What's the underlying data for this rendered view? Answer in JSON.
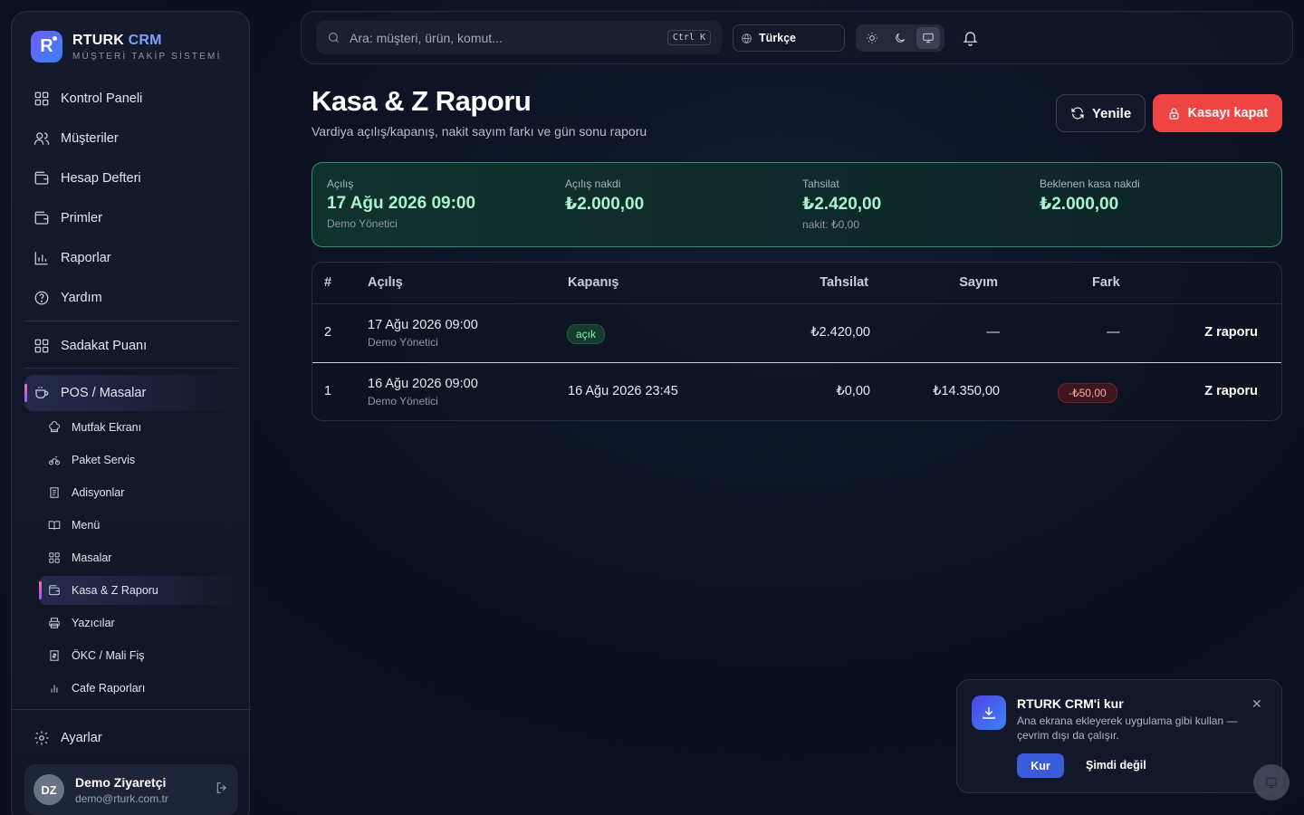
{
  "brand": {
    "name": "RTURK",
    "accent": "CRM",
    "subtitle": "MÜŞTERİ TAKİP SİSTEMİ",
    "logo_letter": "R"
  },
  "sidebar": {
    "items": [
      {
        "label": "Kontrol Paneli",
        "icon": "grid-icon"
      },
      {
        "label": "Müşteriler",
        "icon": "users-icon"
      },
      {
        "label": "Hesap Defteri",
        "icon": "wallet-icon"
      },
      {
        "label": "Primler",
        "icon": "wallet-icon"
      },
      {
        "label": "Raporlar",
        "icon": "bar-chart-icon"
      },
      {
        "label": "Yardım",
        "icon": "help-circle-icon"
      }
    ],
    "loyalty": {
      "label": "Sadakat Puanı",
      "icon": "grid-icon"
    },
    "pos": {
      "label": "POS / Masalar",
      "icon": "coffee-cup-icon"
    },
    "pos_sub": [
      {
        "label": "Mutfak Ekranı",
        "icon": "chef-hat-icon"
      },
      {
        "label": "Paket Servis",
        "icon": "bike-icon"
      },
      {
        "label": "Adisyonlar",
        "icon": "receipt-icon"
      },
      {
        "label": "Menü",
        "icon": "book-icon"
      },
      {
        "label": "Masalar",
        "icon": "grid-icon"
      },
      {
        "label": "Kasa & Z Raporu",
        "icon": "wallet-icon"
      },
      {
        "label": "Yazıcılar",
        "icon": "printer-icon"
      },
      {
        "label": "ÖKC / Mali Fiş",
        "icon": "receipt-icon"
      },
      {
        "label": "Cafe Raporları",
        "icon": "bar-chart-icon"
      }
    ],
    "settings": {
      "label": "Ayarlar",
      "icon": "gear-icon"
    },
    "user": {
      "initials": "DZ",
      "name": "Demo Ziyaretçi",
      "email": "demo@rturk.com.tr"
    }
  },
  "topbar": {
    "search_placeholder": "Ara: müşteri, ürün, komut...",
    "shortcut": "Ctrl K",
    "language": "Türkçe",
    "theme_selected": "system"
  },
  "page": {
    "title": "Kasa & Z Raporu",
    "subtitle": "Vardiya açılış/kapanış, nakit sayım farkı ve gün sonu raporu",
    "refresh_label": "Yenile",
    "close_register_label": "Kasayı kapat"
  },
  "summary": {
    "opening_label": "Açılış",
    "opening_value": "17 Ağu 2026 09:00",
    "opening_by": "Demo Yönetici",
    "opening_cash_label": "Açılış nakdi",
    "opening_cash_value": "₺2.000,00",
    "collection_label": "Tahsilat",
    "collection_value": "₺2.420,00",
    "collection_note": "nakit: ₺0,00",
    "expected_label": "Beklenen kasa nakdi",
    "expected_value": "₺2.000,00"
  },
  "table": {
    "headers": {
      "num": "#",
      "open": "Açılış",
      "close": "Kapanış",
      "collection": "Tahsilat",
      "count": "Sayım",
      "diff": "Fark"
    },
    "rows": [
      {
        "num": "2",
        "open": "17 Ağu 2026 09:00",
        "open_by": "Demo Yönetici",
        "close_badge": "açık",
        "collection": "₺2.420,00",
        "count": "—",
        "diff": "—",
        "action": "Z raporu"
      },
      {
        "num": "1",
        "open": "16 Ağu 2026 09:00",
        "open_by": "Demo Yönetici",
        "close": "16 Ağu 2026 23:45",
        "collection": "₺0,00",
        "count": "₺14.350,00",
        "diff": "-₺50,00",
        "action": "Z raporu"
      }
    ]
  },
  "install_toast": {
    "title": "RTURK CRM'i kur",
    "description": "Ana ekrana ekleyerek uygulama gibi kullan — çevrim dışı da çalışır.",
    "install_label": "Kur",
    "later_label": "Şimdi değil",
    "close_glyph": "✕"
  },
  "colors": {
    "accent": "#7aa2ff",
    "danger": "#ef4444",
    "success": "#a7f3d0",
    "install": "#3b5bdb"
  }
}
